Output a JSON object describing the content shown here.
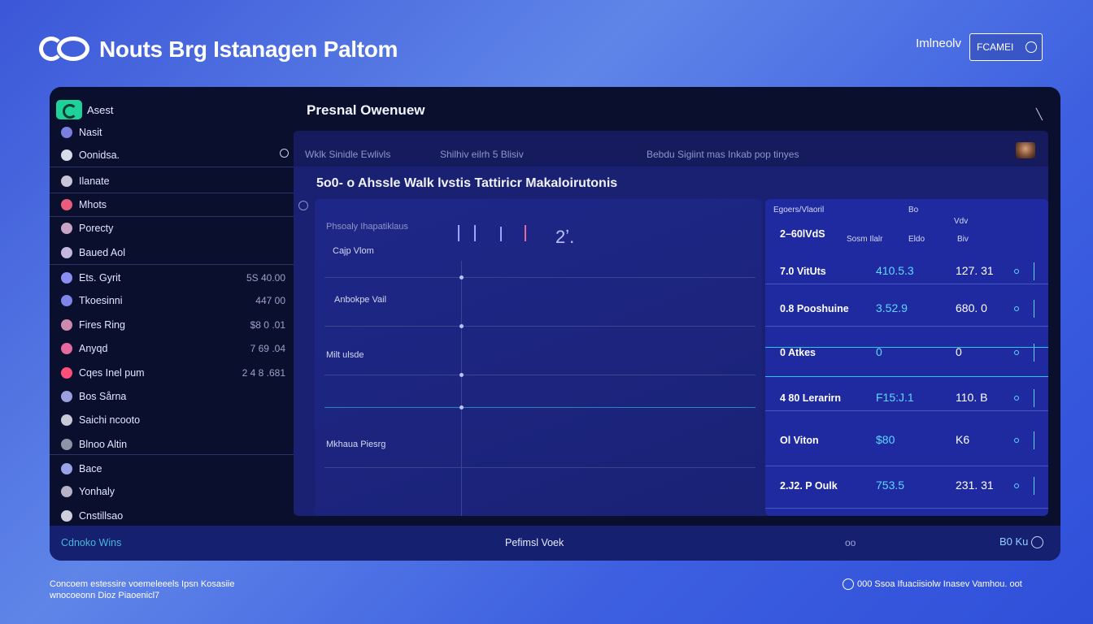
{
  "header": {
    "app_title": "Nouts Brg Istanagen Paltom",
    "user_label": "Imlneolv",
    "account_button": "FCAMEI"
  },
  "sidebar": {
    "title": "Asest",
    "items": [
      {
        "label": "Nasit",
        "value": "",
        "color": "#7b7fe0"
      },
      {
        "label": "Oonidsa.",
        "value": "",
        "color": "#d8dbe8"
      },
      {
        "label": "Ilanate",
        "value": "",
        "color": "#c9c4d8"
      },
      {
        "label": "Mhots",
        "value": "",
        "color": "#ea5d7a"
      },
      {
        "label": "Porecty",
        "value": "",
        "color": "#c8a4c8"
      },
      {
        "label": "Baued Aol",
        "value": "",
        "color": "#c4b8e0"
      },
      {
        "label": "Ets. Gyrit",
        "value": "5S 40.00",
        "color": "#8a8ef0"
      },
      {
        "label": "Tkoesinni",
        "value": "447 00",
        "color": "#7e84e8"
      },
      {
        "label": "Fires Ring",
        "value": "$8 0 .01",
        "color": "#d08aaf"
      },
      {
        "label": "Anyqd",
        "value": "7 69 .04",
        "color": "#e46aa0"
      },
      {
        "label": "Cqes Inel pum",
        "value": "2 4 8 .681",
        "color": "#ff4e7a"
      },
      {
        "label": "Bos Sårna",
        "value": "",
        "color": "#9aa0e0"
      },
      {
        "label": "Saichi ncooto",
        "value": "",
        "color": "#c8cad8"
      },
      {
        "label": "Blnoo Altin",
        "value": "",
        "color": "#8e94a8"
      },
      {
        "label": "Bace",
        "value": "",
        "color": "#9aa2e8"
      },
      {
        "label": "Yonhaly",
        "value": "",
        "color": "#b8b2c8"
      },
      {
        "label": "Cnstillsao",
        "value": "",
        "color": "#d0d0dc"
      }
    ]
  },
  "main": {
    "title": "Presnal Owenuew",
    "tabs": [
      "Wklk Sinidle Ewlivls",
      "Shilhiv eilrh 5 Blisiv",
      "Bebdu Sigiint mas Inkab pop tinyes"
    ],
    "subtitle": "5o0- o Ahssle Walk lvstis Tattiricr Makaloirutonis"
  },
  "chart_panel": {
    "labels": {
      "top": "Phsoaly Ihapatiklaus",
      "a": "Cajp Vlom",
      "b": "Anbokpe Vail",
      "c": "Milt ulsde",
      "d": "Mkhaua Piesrg",
      "big": "2ʼ."
    }
  },
  "table_panel": {
    "head": {
      "title": "Egoers/Vlaoril",
      "c1": "Bo",
      "c2": "Vdv",
      "c3": "Sosm Ilalr",
      "c4": "Eldo",
      "c5": "Biv"
    },
    "rows": [
      {
        "name": "2–60lVdS",
        "v1": "",
        "v2": ""
      },
      {
        "name": "7.0 VitUts",
        "v1": "410.5.3",
        "v2": "127. 31"
      },
      {
        "name": "0.8 Pooshuine",
        "v1": "3.52.9",
        "v2": "680. 0"
      },
      {
        "name": "0 Atkes",
        "v1": "0",
        "v2": "0"
      },
      {
        "name": "4 80 Lerarirn",
        "v1": "F15:J.1",
        "v2": "110. B"
      },
      {
        "name": "Ol Viton",
        "v1": "$80",
        "v2": "K6"
      },
      {
        "name": "2.J2. P Oulk",
        "v1": "753.5",
        "v2": "231. 31"
      }
    ]
  },
  "footer": {
    "left": "Cdnoko Wins",
    "center": "Pefimsl Voek",
    "right1": "oo",
    "right2": "B0 Ku"
  },
  "footnotes": {
    "left_line1": "Concoem estessire voemeleeels Ipsn Kosasiie",
    "left_line2": "wnocoeonn Dioz Piaoenicl7",
    "right": "000 Ssoa Ifuaciisiolw Inasev Vamhou. oot"
  }
}
